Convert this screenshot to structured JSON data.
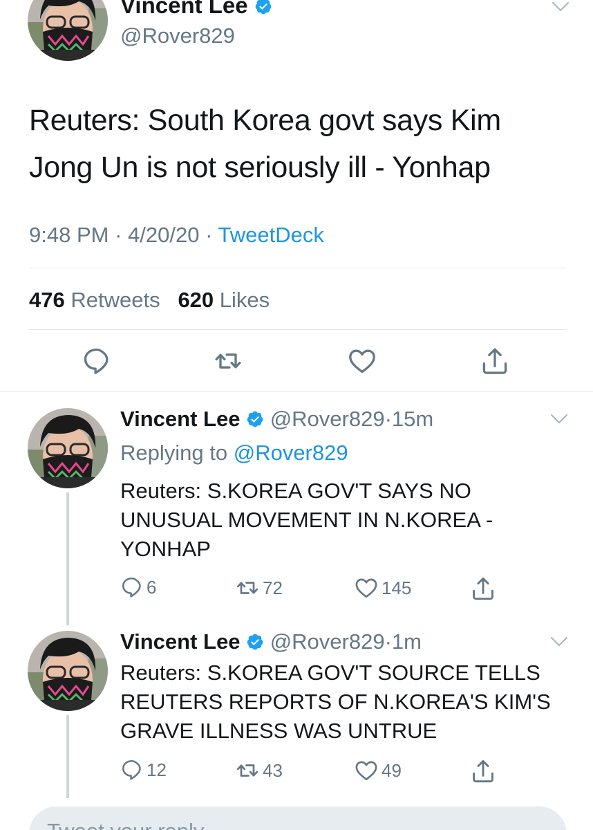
{
  "colors": {
    "link": "#1b95e0",
    "secondary": "#657786",
    "divider": "#e1e8ed",
    "verified": "#1da1f2"
  },
  "main_tweet": {
    "author_name": "Vincent Lee",
    "author_handle": "@Rover829",
    "verified_icon": "verified-badge-icon",
    "text": "Reuters: South Korea govt says Kim Jong Un is not seriously ill - Yonhap",
    "time": "9:48 PM",
    "date": "4/20/20",
    "source": "TweetDeck",
    "separator": "·",
    "retweets_count": "476",
    "retweets_label": "Retweets",
    "likes_count": "620",
    "likes_label": "Likes",
    "actions": [
      "reply-icon",
      "retweet-icon",
      "like-icon",
      "share-icon"
    ]
  },
  "replies": [
    {
      "author_name": "Vincent Lee",
      "author_handle": "@Rover829",
      "separator": "·",
      "time_ago": "15m",
      "replying_prefix": "Replying to",
      "replying_to": "@Rover829",
      "text": "Reuters: S.KOREA GOV'T SAYS NO UNUSUAL MOVEMENT IN N.KOREA - YONHAP",
      "reply_count": "6",
      "retweet_count": "72",
      "like_count": "145"
    },
    {
      "author_name": "Vincent Lee",
      "author_handle": "@Rover829",
      "separator": "·",
      "time_ago": "1m",
      "text": "Reuters: S.KOREA GOV'T SOURCE TELLS REUTERS REPORTS OF N.KOREA'S KIM'S GRAVE ILLNESS WAS UNTRUE",
      "reply_count": "12",
      "retweet_count": "43",
      "like_count": "49"
    }
  ],
  "composer": {
    "placeholder": "Tweet your reply"
  }
}
